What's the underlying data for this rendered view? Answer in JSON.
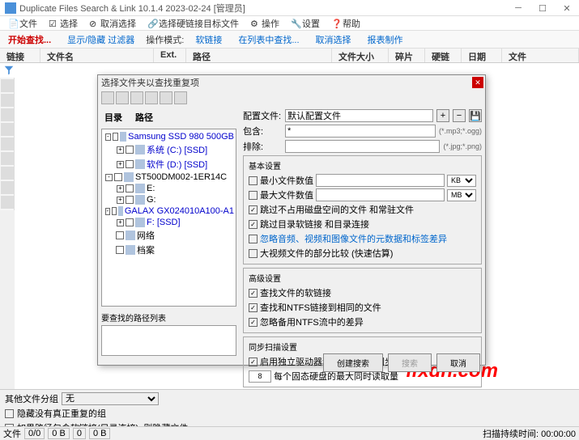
{
  "window": {
    "title": "Duplicate Files Search & Link 10.1.4 2023-02-24 [管理员]"
  },
  "menu": {
    "file": "文件",
    "select": "选择",
    "cancel_select": "取消选择",
    "select_linked": "选择硬链接目标文件",
    "operate": "操作",
    "settings": "设置",
    "help": "帮助"
  },
  "toolbar": {
    "start_search": "开始查找...",
    "show_hide_filter": "显示/隐藏 过滤器",
    "mode_label": "操作模式:",
    "soft_link": "软链接",
    "search_in_list": "在列表中查找...",
    "deselect": "取消选择",
    "report": "报表制作"
  },
  "columns": {
    "link": "链接",
    "filename": "文件名",
    "ext": "Ext.",
    "path": "路径",
    "size": "文件大小",
    "fragment": "碎片",
    "hardlink": "硬链",
    "date": "日期",
    "file": "文件"
  },
  "dialog": {
    "title": "选择文件夹以查找重复项",
    "tabs": {
      "dir": "目录",
      "path": "路径"
    },
    "tree": [
      {
        "level": 0,
        "exp": "-",
        "chk": true,
        "label": "Samsung SSD 980 500GB",
        "blue": true
      },
      {
        "level": 1,
        "exp": "+",
        "chk": true,
        "label": "系统 (C:) [SSD]",
        "blue": true
      },
      {
        "level": 1,
        "exp": "+",
        "chk": true,
        "label": "软件 (D:) [SSD]",
        "blue": true
      },
      {
        "level": 0,
        "exp": "-",
        "chk": true,
        "label": "ST500DM002-1ER14C"
      },
      {
        "level": 1,
        "exp": "+",
        "chk": true,
        "label": "E:"
      },
      {
        "level": 1,
        "exp": "+",
        "chk": true,
        "label": "G:"
      },
      {
        "level": 0,
        "exp": "-",
        "chk": true,
        "label": "GALAX GX024010A100-A1",
        "blue": true
      },
      {
        "level": 1,
        "exp": "+",
        "chk": true,
        "label": "F: [SSD]",
        "blue": true
      },
      {
        "level": 0,
        "exp": "",
        "chk": true,
        "label": "网络"
      },
      {
        "level": 0,
        "exp": "",
        "chk": true,
        "label": "档案"
      }
    ],
    "path_list_label": "要查找的路径列表",
    "config_label": "配置文件:",
    "config_value": "默认配置文件",
    "include_label": "包含:",
    "include_value": "*",
    "include_hint": "(*.mp3;*.ogg)",
    "exclude_label": "排除:",
    "exclude_hint": "(*.jpg;*.png)",
    "basic": {
      "title": "基本设置",
      "min_size": "最小文件数值",
      "max_size": "最大文件数值",
      "unit_kb": "KB",
      "unit_mb": "MB",
      "skip_zero": "跳过不占用磁盘空间的文件 和常驻文件",
      "skip_links": "跳过目录软链接 和目录连接",
      "ignore_media": "忽略音频、视频和图像文件的元数据和标签差异",
      "compare_large": "大视频文件的部分比较 (快速估算)"
    },
    "advanced": {
      "title": "高级设置",
      "find_symlinks": "查找文件的软链接",
      "find_ntfs": "查找和NTFS链接到相同的文件",
      "ignore_ntfs_diff": "忽略备用NTFS流中的差异"
    },
    "sync": {
      "title": "同步扫描设置",
      "enable": "启用独立驱动器和固态硬盘的同步扫描",
      "threads": "8",
      "threads_label": "每个固态硬盘的最大同时读取量"
    },
    "buttons": {
      "create_index": "创建搜索",
      "start_search": "搜索",
      "cancel": "取消"
    }
  },
  "watermark": "ifxdh.com",
  "bottom": {
    "other_group": "其他文件分组",
    "none": "无",
    "hide_non_dup": "隐藏没有真正重复的组",
    "include_symlinks": "如果路径包含软链接(目录连接), 则隐藏文件"
  },
  "status": {
    "files": "文件",
    "v1": "0/0",
    "v2": "0 B",
    "v3": "0",
    "v4": "0 B",
    "scan_time": "扫描持续时间: 00:00:00"
  }
}
